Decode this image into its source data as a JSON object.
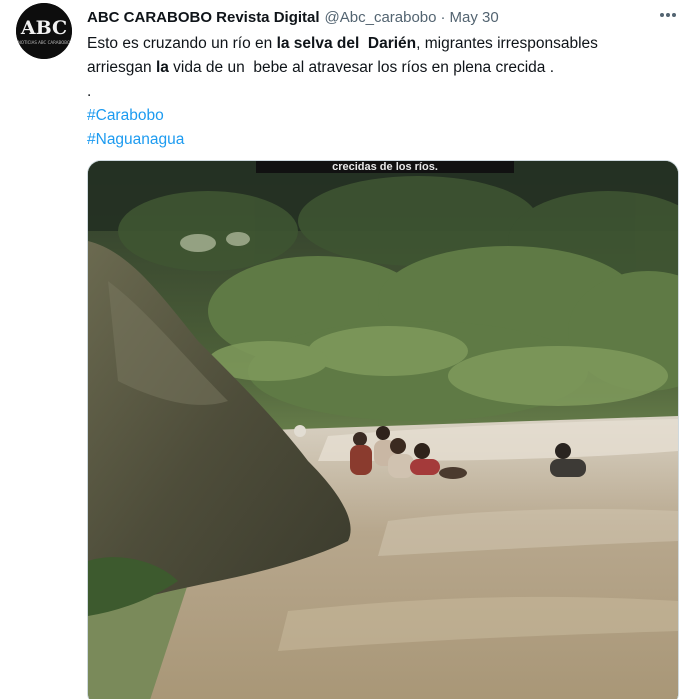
{
  "author": {
    "display_name": "ABC CARABOBO Revista Digital",
    "handle": "@Abc_carabobo",
    "separator": "·",
    "date": "May 30",
    "avatar_text": "ABC",
    "avatar_subtext": "NOTICIAS ABC CARABOBO"
  },
  "tweet": {
    "line1_a": "Esto es cruzando un río en ",
    "line1_b": "la selva del  Darién",
    "line1_c": ", migrantes irresponsables",
    "line2_a": "arriesgan ",
    "line2_b": "la",
    "line2_c": " vida de un  bebe al atravesar los ríos en plena crecida .",
    "line3": ".",
    "hashtags": [
      "#Carabobo",
      "#Naguanagua"
    ]
  },
  "media": {
    "caption": "crecidas de los ríos."
  },
  "colors": {
    "link": "#1d9bf0",
    "secondary_text": "#536471",
    "primary_text": "#0f1419"
  },
  "icons": {
    "more": "more-horizontal-icon"
  }
}
